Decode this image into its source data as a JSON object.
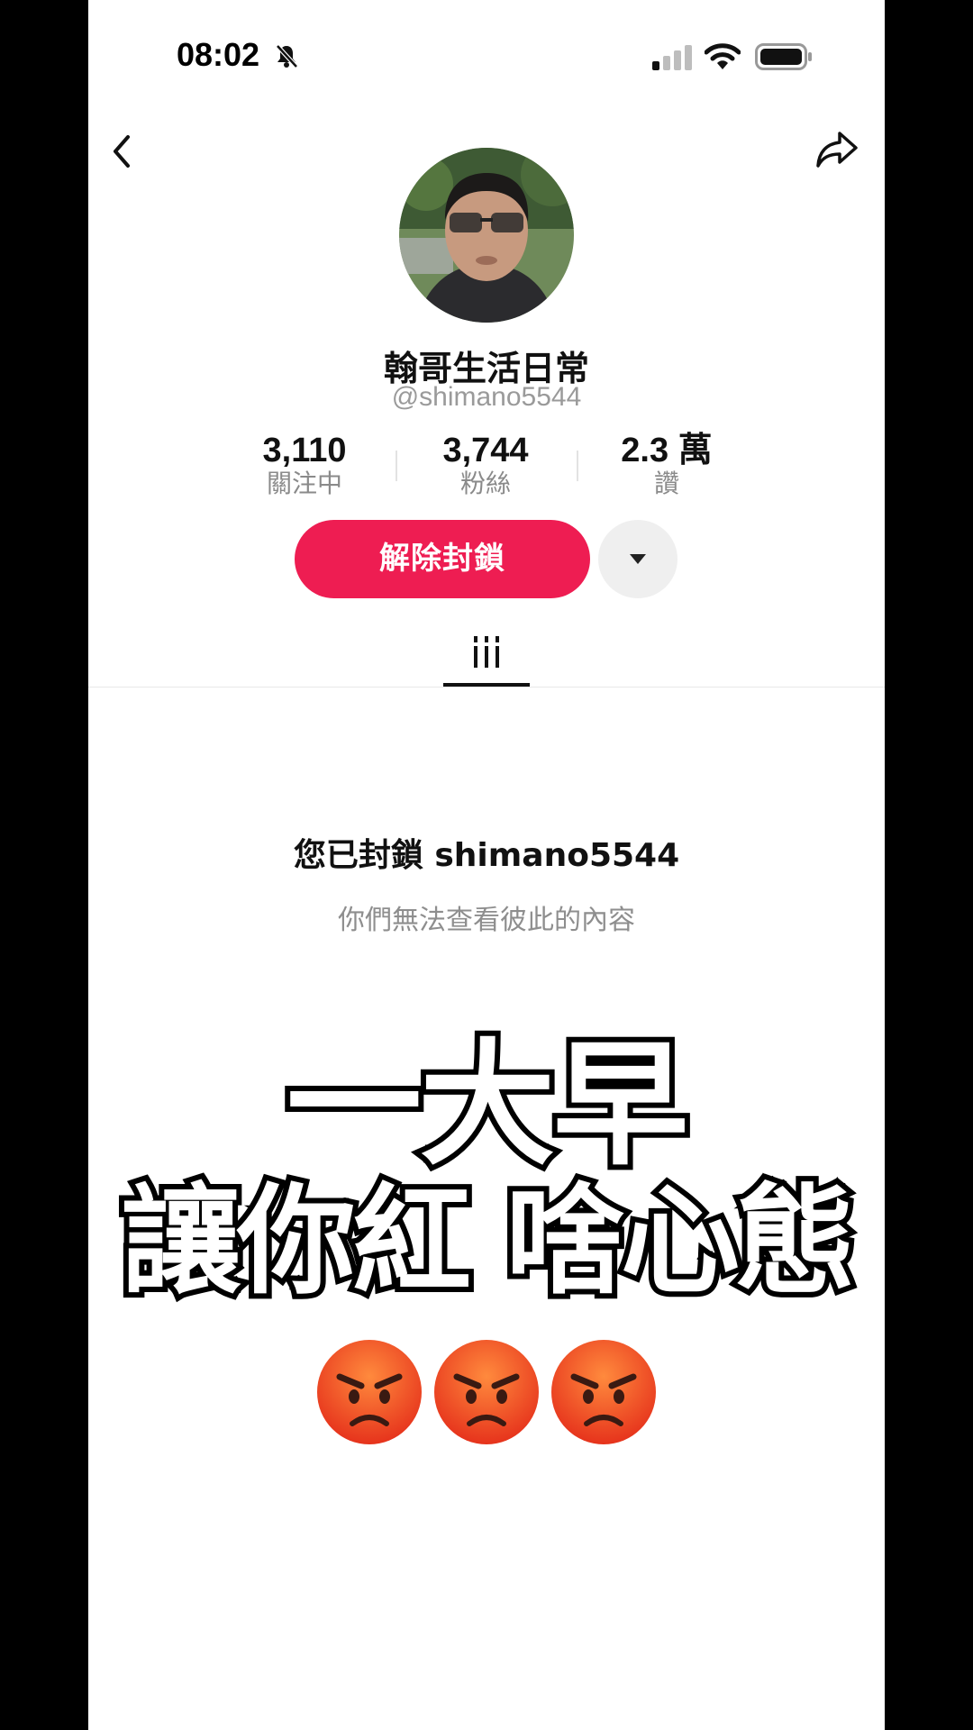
{
  "status_bar": {
    "time": "08:02",
    "icons": [
      "bell-muted-icon",
      "signal-icon",
      "wifi-icon",
      "battery-icon"
    ]
  },
  "nav": {
    "back_icon": "chevron-left-icon",
    "share_icon": "share-arrow-icon"
  },
  "profile": {
    "display_name": "翰哥生活日常",
    "username": "@shimano5544",
    "stats": [
      {
        "value": "3,110",
        "label": "關注中"
      },
      {
        "value": "3,744",
        "label": "粉絲"
      },
      {
        "value": "2.3 萬",
        "label": "讚"
      }
    ],
    "unblock_label": "解除封鎖",
    "accent_color": "#ee1d52"
  },
  "tabs": {
    "active_icon": "grid-icon"
  },
  "blocked_notice": {
    "title": "您已封鎖 shimano5544",
    "subtitle": "你們無法查看彼此的內容"
  },
  "caption": {
    "line1": "一大早",
    "line2": "讓你紅 啥心態",
    "emoji": "angry-face-icon",
    "emoji_count": 3
  }
}
